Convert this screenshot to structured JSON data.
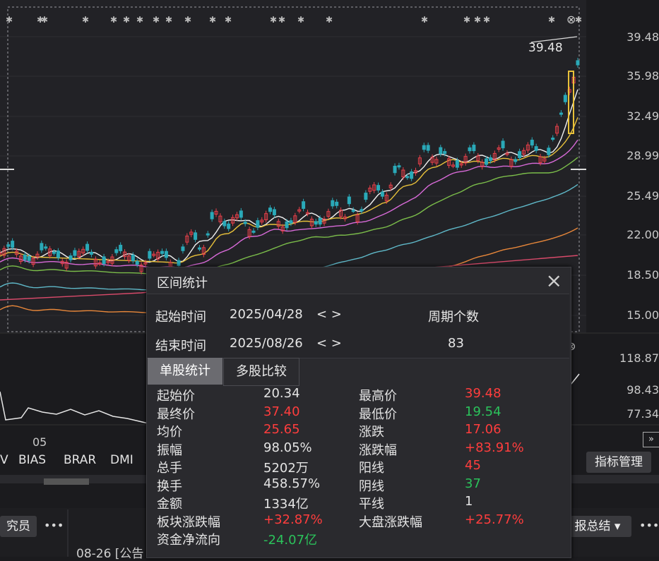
{
  "axis_main": [
    "39.48",
    "35.98",
    "32.49",
    "28.99",
    "25.49",
    "22.00",
    "18.50",
    "15.00"
  ],
  "axis_sub": [
    "118.87",
    "98.43",
    "77.34"
  ],
  "date_tick": "05",
  "price_annotation": "39.48",
  "toolbar": [
    "V",
    "BIAS",
    "BRAR",
    "DMI"
  ],
  "indicator_btn": "指标管理",
  "bottom": {
    "left_btn": "究员",
    "more": "•••",
    "date_text": "08-26 [公告",
    "report_btn": "报总结"
  },
  "popup": {
    "title": "区间统计",
    "start_label": "起始时间",
    "start_value": "2025/04/28",
    "end_label": "结束时间",
    "end_value": "2025/08/26",
    "nav": "< >",
    "period_label": "周期个数",
    "period_value": "83",
    "tab_single": "单股统计",
    "tab_multi": "多股比较",
    "stats_left": [
      {
        "k": "起始价",
        "v": "20.34",
        "c": "white"
      },
      {
        "k": "最终价",
        "v": "37.40",
        "c": "red"
      },
      {
        "k": "均价",
        "v": "25.65",
        "c": "red"
      },
      {
        "k": "振幅",
        "v": "98.05%",
        "c": "white"
      },
      {
        "k": "总手",
        "v": "5202万",
        "c": "white"
      },
      {
        "k": "换手",
        "v": "458.57%",
        "c": "white"
      },
      {
        "k": "金额",
        "v": "1334亿",
        "c": "white"
      },
      {
        "k": "板块涨跌幅",
        "v": "+32.87%",
        "c": "red"
      },
      {
        "k": "资金净流向",
        "v": "-24.07亿",
        "c": "green"
      }
    ],
    "stats_right": [
      {
        "k": "最高价",
        "v": "39.48",
        "c": "red"
      },
      {
        "k": "最低价",
        "v": "19.54",
        "c": "green"
      },
      {
        "k": "涨跌",
        "v": "17.06",
        "c": "red"
      },
      {
        "k": "涨跌幅",
        "v": "+83.91%",
        "c": "red"
      },
      {
        "k": "阳线",
        "v": "45",
        "c": "red"
      },
      {
        "k": "阴线",
        "v": "37",
        "c": "green"
      },
      {
        "k": "平线",
        "v": "1",
        "c": "white"
      },
      {
        "k": "大盘涨跌幅",
        "v": "+25.77%",
        "c": "red"
      }
    ]
  }
}
